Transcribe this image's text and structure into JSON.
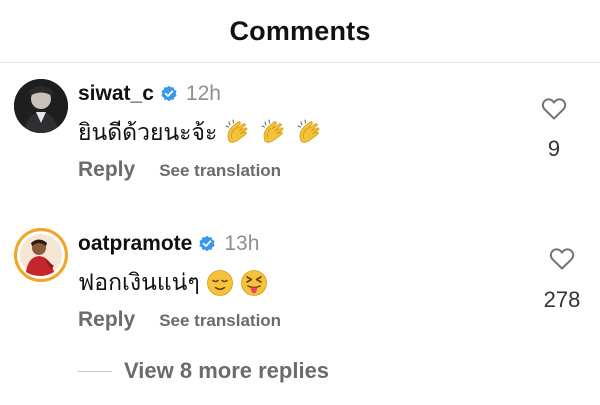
{
  "header": {
    "title": "Comments"
  },
  "comments": [
    {
      "username": "siwat_c",
      "verified": true,
      "time": "12h",
      "text": "ยินดีด้วยนะจ้ะ",
      "emojis": [
        "clapping-hands",
        "clapping-hands",
        "clapping-hands"
      ],
      "reply_label": "Reply",
      "translation_label": "See translation",
      "likes": "9"
    },
    {
      "username": "oatpramote",
      "verified": true,
      "time": "13h",
      "text": "ฟอกเงินแน่ๆ",
      "emojis": [
        "relieved-face",
        "squinting-face-with-tongue"
      ],
      "reply_label": "Reply",
      "translation_label": "See translation",
      "likes": "278"
    }
  ],
  "view_more": {
    "label": "View 8 more replies"
  },
  "colors": {
    "verified": "#3897f0",
    "muted": "#8e8e8e",
    "emoji_yellow": "#f5c33b",
    "story_ring": "#f1a627"
  }
}
